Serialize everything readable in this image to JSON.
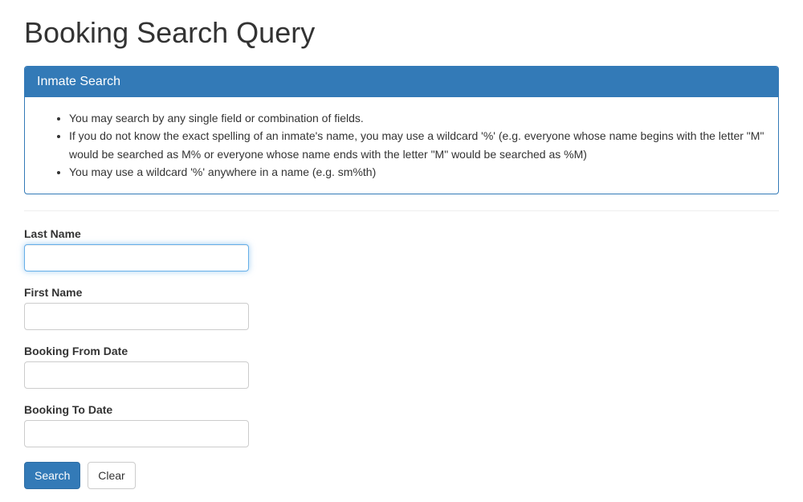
{
  "page": {
    "title": "Booking Search Query"
  },
  "panel": {
    "heading": "Inmate Search",
    "instructions": [
      "You may search by any single field or combination of fields.",
      "If you do not know the exact spelling of an inmate's name, you may use a wildcard '%' (e.g. everyone whose name begins with the letter \"M\" would be searched as M% or everyone whose name ends with the letter \"M\" would be searched as %M)",
      "You may use a wildcard '%' anywhere in a name (e.g. sm%th)"
    ]
  },
  "form": {
    "last_name": {
      "label": "Last Name",
      "value": ""
    },
    "first_name": {
      "label": "First Name",
      "value": ""
    },
    "booking_from": {
      "label": "Booking From Date",
      "value": ""
    },
    "booking_to": {
      "label": "Booking To Date",
      "value": ""
    }
  },
  "buttons": {
    "search": "Search",
    "clear": "Clear"
  }
}
